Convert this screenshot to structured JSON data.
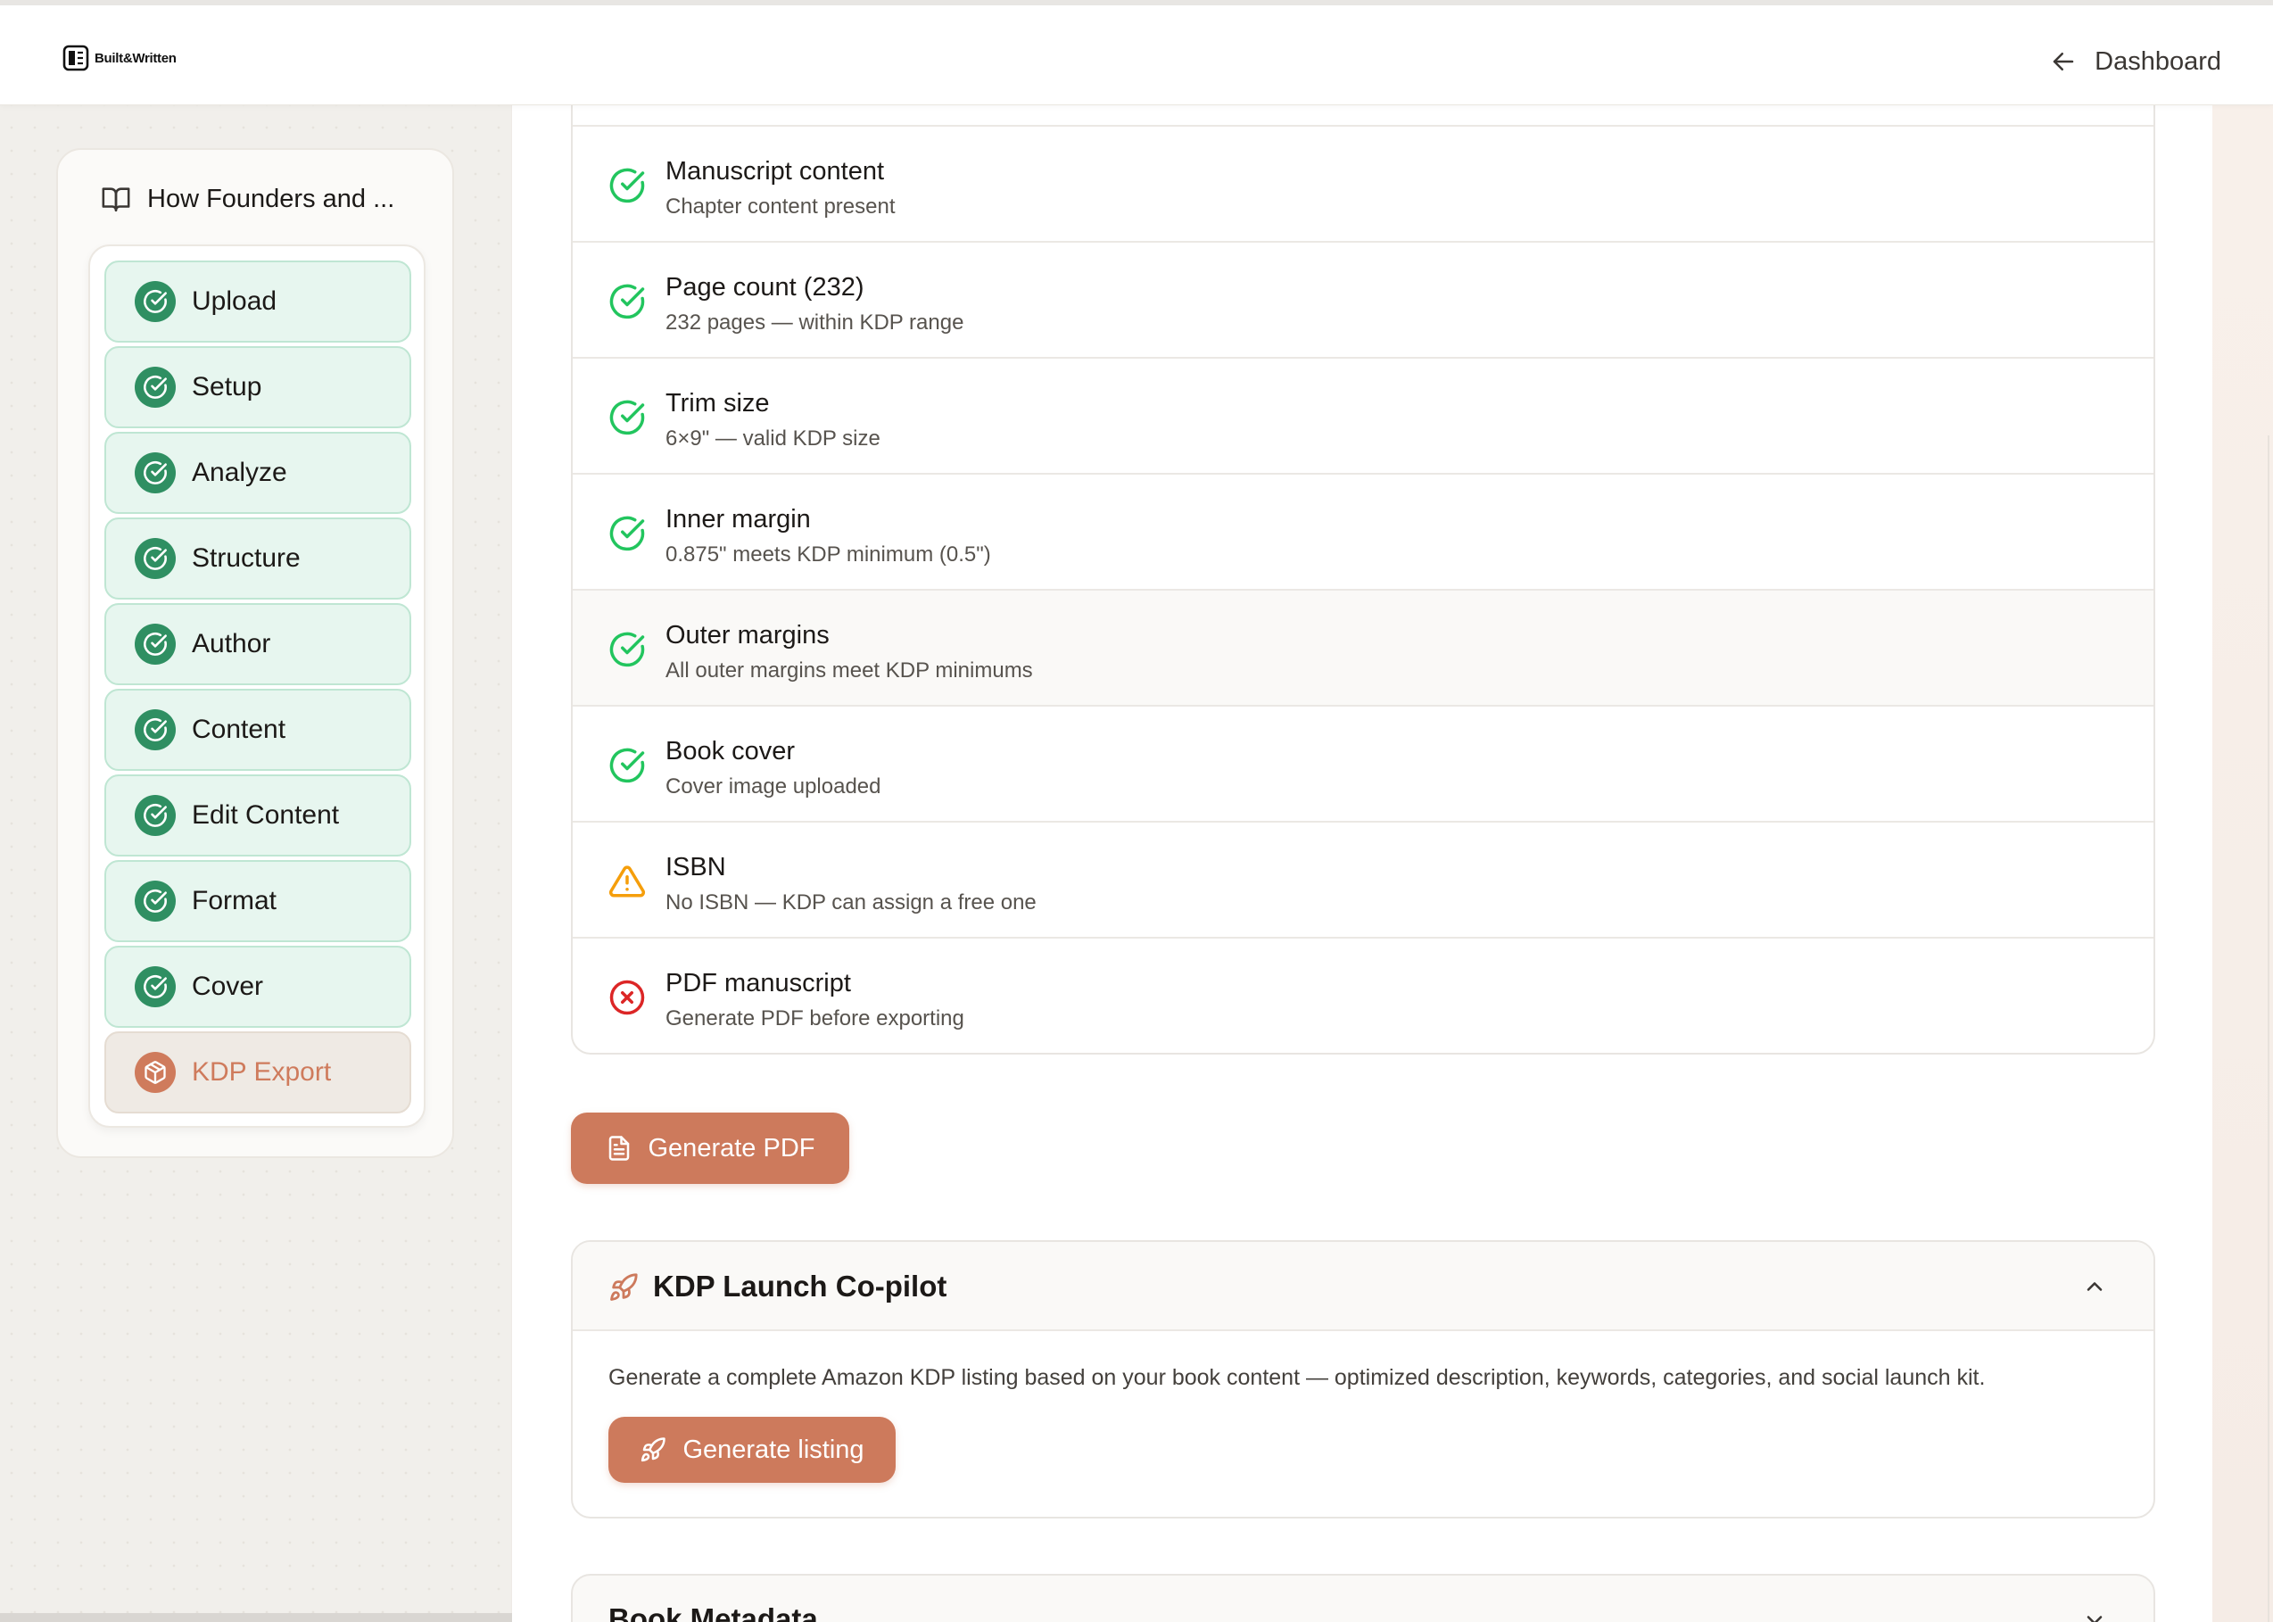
{
  "header": {
    "logo_text": "Built&Written",
    "dashboard_label": "Dashboard"
  },
  "sidebar": {
    "book_title": "How Founders and ...",
    "steps": [
      {
        "label": "Upload",
        "status": "complete"
      },
      {
        "label": "Setup",
        "status": "complete"
      },
      {
        "label": "Analyze",
        "status": "complete"
      },
      {
        "label": "Structure",
        "status": "complete"
      },
      {
        "label": "Author",
        "status": "complete"
      },
      {
        "label": "Content",
        "status": "complete"
      },
      {
        "label": "Edit Content",
        "status": "complete"
      },
      {
        "label": "Format",
        "status": "complete"
      },
      {
        "label": "Cover",
        "status": "complete"
      },
      {
        "label": "KDP Export",
        "status": "active"
      }
    ]
  },
  "checklist": [
    {
      "title": "Manuscript content",
      "subtitle": "Chapter content present",
      "status": "pass"
    },
    {
      "title": "Page count (232)",
      "subtitle": "232 pages — within KDP range",
      "status": "pass"
    },
    {
      "title": "Trim size",
      "subtitle": "6×9\" — valid KDP size",
      "status": "pass"
    },
    {
      "title": "Inner margin",
      "subtitle": "0.875\" meets KDP minimum (0.5\")",
      "status": "pass"
    },
    {
      "title": "Outer margins",
      "subtitle": "All outer margins meet KDP minimums",
      "status": "pass"
    },
    {
      "title": "Book cover",
      "subtitle": "Cover image uploaded",
      "status": "pass"
    },
    {
      "title": "ISBN",
      "subtitle": "No ISBN — KDP can assign a free one",
      "status": "warning"
    },
    {
      "title": "PDF manuscript",
      "subtitle": "Generate PDF before exporting",
      "status": "fail"
    }
  ],
  "actions": {
    "generate_pdf_label": "Generate PDF"
  },
  "copilot": {
    "title": "KDP Launch Co-pilot",
    "description": "Generate a complete Amazon KDP listing based on your book content — optimized description, keywords, categories, and social launch kit.",
    "button_label": "Generate listing",
    "expanded": true
  },
  "metadata_section": {
    "title": "Book Metadata",
    "expanded": false
  },
  "colors": {
    "accent": "#cd7a5c",
    "success": "#22c55e",
    "success_badge": "#2f8f62",
    "warning": "#f59e0b",
    "error": "#dc2626"
  }
}
